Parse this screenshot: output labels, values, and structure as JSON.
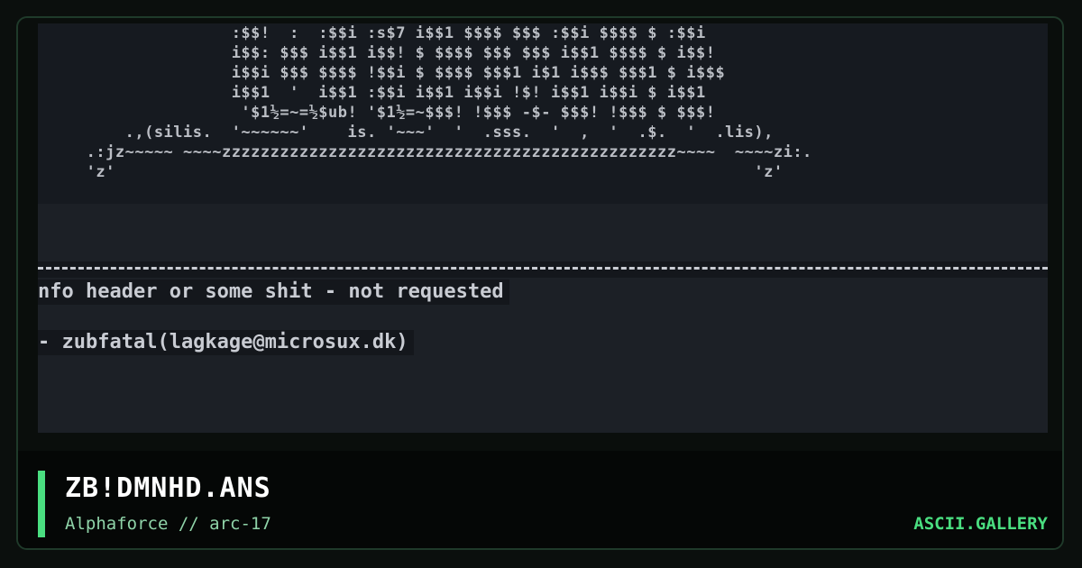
{
  "preview": {
    "art_lines": [
      "                    :$$!  :  :$$i :s$7 i$$1 $$$$ $$$ :$$i $$$$ $ :$$i",
      "                    i$$: $$$ i$$1 i$$! $ $$$$ $$$ $$$ i$$1 $$$$ $ i$$!",
      "                    i$$i $$$ $$$$ !$$i $ $$$$ $$$1 i$1 i$$$ $$$1 $ i$$$",
      "                    i$$1  '  i$$1 :$$i i$$1 i$$i !$! i$$1 i$$i $ i$$1",
      "                     '$1½=~=½$ub! '$1½=~$$$! !$$$ -$- $$$! !$$$ $ $$$!",
      "         .,(silis.  '~~~~~~'    is. '~~~'  '  .sss.  '  ,  '  .$.  '  .lis),",
      "     .:jz~~~~~ ~~~~zzzzzzzzzzzzzzzzzzzzzzzzzzzzzzzzzzzzzzzzzzzzzzz~~~~  ~~~~zi:.",
      "     'z'                                                                  'z'"
    ],
    "info_line": "nfo header or some shit - not requested",
    "author_line": "- zubfatal(lagkage@microsux.dk)"
  },
  "footer": {
    "title": "ZB!DMNHD.ANS",
    "subtitle": "Alphaforce // arc-17",
    "brand": "ASCII.GALLERY"
  }
}
